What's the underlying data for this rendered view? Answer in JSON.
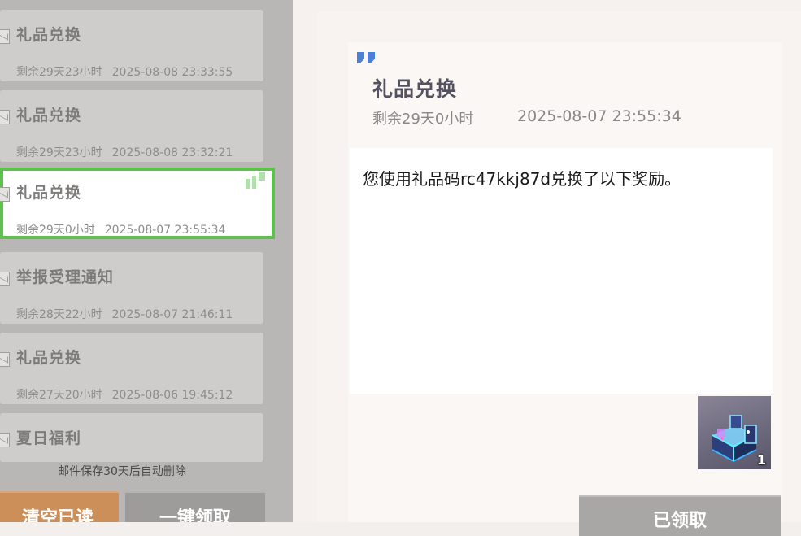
{
  "mail_list": {
    "items": [
      {
        "title": "礼品兑换",
        "remaining": "剩余29天23小时",
        "time": "2025-08-08 23:33:55"
      },
      {
        "title": "礼品兑换",
        "remaining": "剩余29天23小时",
        "time": "2025-08-08 23:32:21"
      },
      {
        "title": "礼品兑换",
        "remaining": "剩余29天0小时",
        "time": "2025-08-07 23:55:34"
      },
      {
        "title": "举报受理通知",
        "remaining": "剩余28天22小时",
        "time": "2025-08-07 21:46:11"
      },
      {
        "title": "礼品兑换",
        "remaining": "剩余27天20小时",
        "time": "2025-08-06 19:45:12"
      },
      {
        "title": "夏日福利",
        "remaining": "",
        "time": ""
      }
    ],
    "footer_note": "邮件保存30天后自动删除",
    "clear_read_label": "清空已读",
    "claim_all_label": "一键领取"
  },
  "detail": {
    "title": "礼品兑换",
    "remaining": "剩余29天0小时",
    "time": "2025-08-07 23:55:34",
    "body": "您使用礼品码rc47kkj87d兑换了以下奖励。",
    "reward": {
      "icon": "gift-box-icon",
      "count": "1"
    },
    "claimed_label": "已领取"
  },
  "colors": {
    "selected_border": "#5fbf4f",
    "quote_accent": "#4b7fd8",
    "clear_button": "#cc8f5a",
    "disabled_button": "#9e9c9b"
  }
}
